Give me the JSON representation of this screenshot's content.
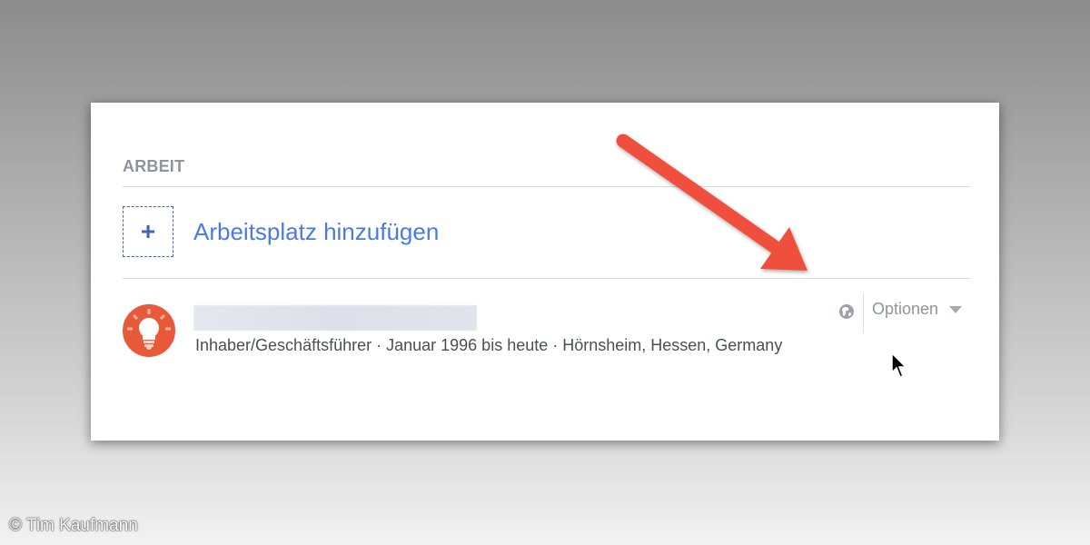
{
  "section": {
    "title": "ARBEIT"
  },
  "add_workplace": {
    "icon": "plus-icon",
    "plus_symbol": "+",
    "label": "Arbeitsplatz hinzufügen"
  },
  "job": {
    "avatar_icon": "lightbulb-icon",
    "details": "Inhaber/Geschäftsführer · Januar 1996 bis heute · Hörnsheim, Hessen, Germany",
    "privacy_icon": "globe-icon",
    "options_label": "Optionen",
    "options_icon": "caret-down-icon"
  },
  "colors": {
    "link_blue": "#4b7be0",
    "section_gray": "#8e949b",
    "annotation_arrow": "#f04f3e",
    "avatar_orange": "#e8593a"
  },
  "credit": "© Tim Kaufmann"
}
